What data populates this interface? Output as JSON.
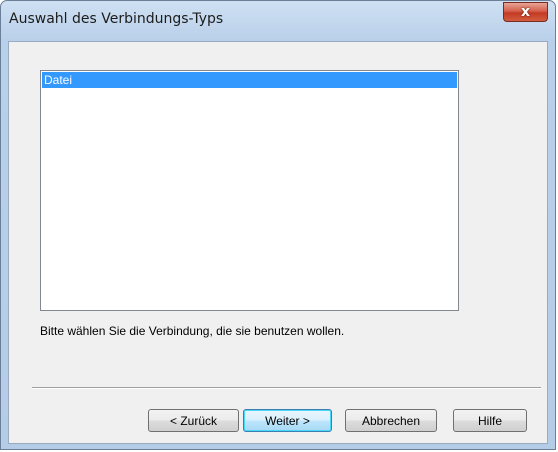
{
  "window": {
    "title": "Auswahl des Verbindungs-Typs",
    "close_glyph": "x"
  },
  "connection_list": {
    "items": [
      {
        "label": "Datei",
        "selected": true
      }
    ]
  },
  "prompt_text": "Bitte wählen Sie die Verbindung, die sie benutzen wollen.",
  "buttons": {
    "back": "< Zurück",
    "next": "Weiter >",
    "cancel": "Abbrechen",
    "help": "Hilfe"
  },
  "colors": {
    "selection": "#3399ff",
    "close_button": "#c43a23",
    "dialog_face": "#f0f0f0"
  }
}
